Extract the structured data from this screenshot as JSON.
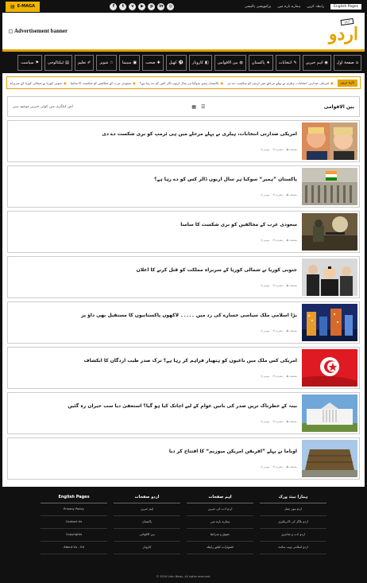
{
  "topbar": {
    "emag_label": "E-MAGA",
    "social_icons": [
      "facebook-icon",
      "twitter-icon",
      "vimeo-icon",
      "youtube-icon",
      "pinterest-icon",
      "linkedin-icon",
      "instagram-icon"
    ],
    "social_glyphs": [
      "f",
      "t",
      "v",
      "▶",
      "p",
      "in",
      "◎"
    ],
    "links": [
      "رابطہ کریں",
      "ہمارے بارے میں",
      "پرائیویسی پالیسی"
    ],
    "lang_label": "English Pages"
  },
  "header": {
    "ad_text": "Advertisement banner",
    "logo_text": "اردو",
    "logo_tag": "اردو"
  },
  "nav": {
    "items": [
      {
        "label": "صفحۂ اول",
        "icon": "⌂"
      },
      {
        "label": "اہم خبریں",
        "icon": "◉"
      },
      {
        "label": "انتخابات",
        "icon": "✎"
      },
      {
        "label": "پاکستان",
        "icon": "★"
      },
      {
        "label": "بین الاقوامی",
        "icon": "◍"
      },
      {
        "label": "کاروبار",
        "icon": "◧"
      },
      {
        "label": "کھیل",
        "icon": "⚽"
      },
      {
        "label": "صحت",
        "icon": "✚"
      },
      {
        "label": "سینما",
        "icon": "▣"
      },
      {
        "label": "شوبز",
        "icon": "☆"
      },
      {
        "label": "تعلیم",
        "icon": "✐"
      },
      {
        "label": "ٹیکنالوجی",
        "icon": "▤"
      },
      {
        "label": "سیاست",
        "icon": "⚑"
      }
    ]
  },
  "ticker": {
    "label": "تازہ ترین",
    "items": [
      "امریکی صدارتی انتخابات، ہیلری نے پہلے مرحلے میں ٹرمپ کو شکست دے دی",
      "پاکستان ہمیر سوکیا ہر سال اربوں ڈالر کس کو دے رہا ہے؟",
      "سعودی عرب کے مخالفین کو شکست کا سامنا",
      "جنوبی کوریا نے شمالی کوریا کے سربراہ",
      "اسلامی ملک میں سیاسی بحران"
    ]
  },
  "section": {
    "title": "بین الاقوامی",
    "no_category": "اس کیٹگری میں کوئی خبریں موجود ہیں",
    "grid_icon": "▦",
    "list_icon": "☰"
  },
  "articles": [
    {
      "title": "امریکی صدارتی انتخابات، ہیلری نے پہلے مرحلے میں ہی ٹرمپ کو بری شکست دے دی",
      "meta": [
        "نومبر",
        "تبصرہ",
        "مصنف"
      ],
      "thumb": "thumb-election"
    },
    {
      "title": "پاکستان ”ہمیر“ سوکیا ہر سال اربوں ڈالر کس کو دے رہا ہے؟",
      "meta": [
        "نومبر",
        "تبصرہ",
        "مصنف"
      ],
      "thumb": "thumb-parliament"
    },
    {
      "title": "سعودی عرب کے مخالفین کو بری شکست کا سامنا",
      "meta": [
        "نومبر",
        "تبصرہ",
        "مصنف"
      ],
      "thumb": "thumb-soldiers"
    },
    {
      "title": "جنوبی کوریا نے شمالی کوریا کے سربراہ مملکت کو قتل کرنے کا اعلان",
      "meta": [
        "نومبر",
        "تبصرہ",
        "مصنف"
      ],
      "thumb": "thumb-korea"
    },
    {
      "title": "بڑا اسلامی ملک سیاسی خسارے کی زد میں ۔۔۔۔۔ لاکھوں پاکستانیوں کا مستقبل بھی داؤ پر",
      "meta": [
        "نومبر",
        "تبصرہ",
        "مصنف"
      ],
      "thumb": "thumb-city"
    },
    {
      "title": "امریکی کس ملک میں باغیوں کو ہتھیار فراہم کر رہا ہے؟ ترک صدر طیب اردگان کا انکشاف",
      "meta": [
        "نومبر",
        "تبصرہ",
        "مصنف"
      ],
      "thumb": "thumb-flag"
    },
    {
      "title": "بینہ کے خطرناک ترین صدر کی باتیں عوام کے لیے اچانک کیا ہو گیا؟ استعفیٰ دیا سب حیران رہ گئیں",
      "meta": [
        "نومبر",
        "تبصرہ",
        "مصنف"
      ],
      "thumb": "thumb-whitehouse"
    },
    {
      "title": "اوباما نے پہلے ”افریقن امریکن میوزیم“ کا افتتاح کر دیا",
      "meta": [
        "نومبر",
        "تبصرہ",
        "مصنف"
      ],
      "thumb": "thumb-museum"
    }
  ],
  "footer": {
    "columns": [
      {
        "heading": "ہمارا نیٹ ورک",
        "links": [
          "اردو نیوز چینل",
          "اردو بلاگز کی ڈائریکٹری",
          "اردو ادب و شاعری",
          "اردو اسلامی ویب سائٹ"
        ]
      },
      {
        "heading": "اہم صفحات",
        "links": [
          "اردو ادب کی خبریں",
          "ہمارے بارے میں",
          "حقوق و شرائط",
          "اشتہارات کیلئے رابطہ"
        ]
      },
      {
        "heading": "اردو صفحات",
        "links": [
          "اہم خبریں",
          "پاکستان",
          "بین الاقوامی",
          "کاروبار"
        ]
      },
      {
        "heading": "English Pages",
        "links": [
          "Privacy Policy",
          "Contact Us",
          "Copyrights",
          "About Us - Ed"
        ]
      }
    ],
    "copyright": "© 2016 Urdu News. All rights reserved."
  }
}
